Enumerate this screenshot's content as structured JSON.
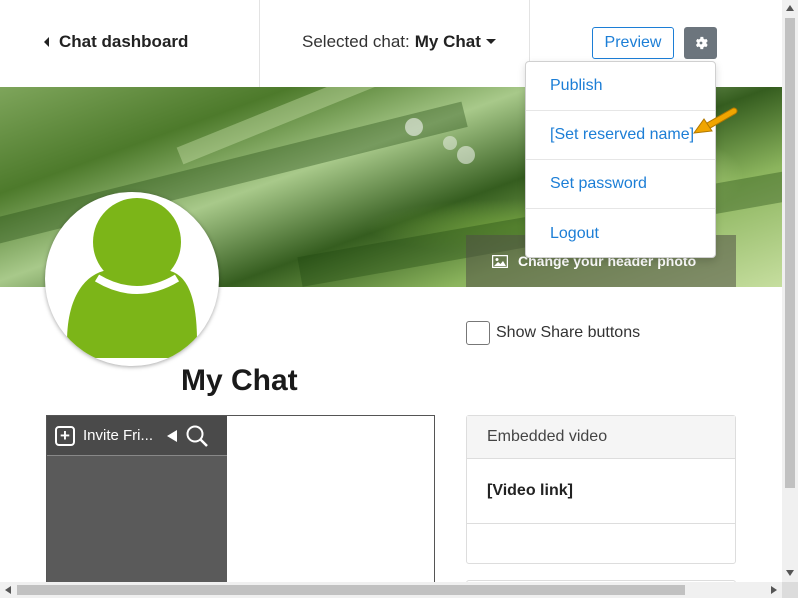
{
  "nav": {
    "back_label": "Chat dashboard",
    "selected_chat_prefix": "Selected chat:",
    "selected_chat_name": "My Chat",
    "preview_label": "Preview"
  },
  "header": {
    "change_photo_label": "Change your header photo"
  },
  "settings_menu": {
    "items": [
      {
        "label": "Publish"
      },
      {
        "label": "[Set reserved name]"
      },
      {
        "label": "Set password"
      },
      {
        "label": "Logout"
      }
    ]
  },
  "profile": {
    "share_label": "Show Share buttons",
    "share_checked": false,
    "chat_title": "My Chat"
  },
  "chat_widget": {
    "invite_label": "Invite Fri..."
  },
  "video_card": {
    "title": "Embedded video",
    "link_label": "[Video link]"
  },
  "colors": {
    "accent": "#1c7ed6",
    "gear_button": "#6c757d",
    "avatar_green": "#7cb518",
    "callout_arrow": "#f0a500"
  },
  "icons": [
    "back-triangle-icon",
    "caret-down-icon",
    "gear-icon",
    "image-icon",
    "user-avatar-icon",
    "plus-square-icon",
    "collapse-left-icon",
    "search-icon",
    "callout-arrow-icon"
  ]
}
